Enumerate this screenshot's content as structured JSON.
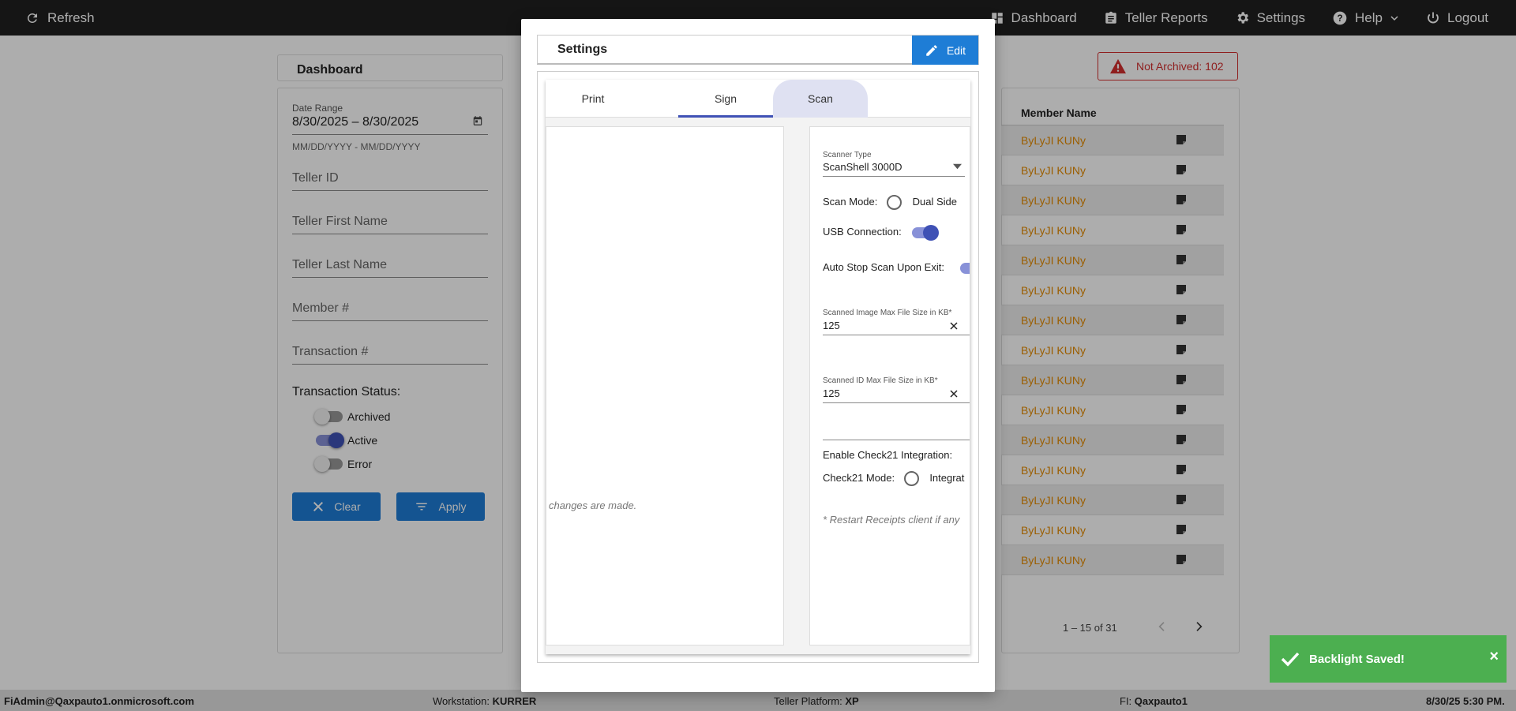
{
  "topbar": {
    "refresh": "Refresh",
    "dashboard": "Dashboard",
    "teller_reports": "Teller Reports",
    "settings": "Settings",
    "help": "Help",
    "logout": "Logout"
  },
  "dashboard": {
    "title": "Dashboard",
    "not_archived": "Not Archived: 102",
    "filters": {
      "date_range_label": "Date Range",
      "date_range_value": "8/30/2025 – 8/30/2025",
      "date_range_hint": "MM/DD/YYYY - MM/DD/YYYY",
      "teller_id": "Teller ID",
      "teller_first_name": "Teller First Name",
      "teller_last_name": "Teller Last Name",
      "member_number": "Member #",
      "transaction_number": "Transaction #",
      "status_title": "Transaction Status:",
      "status": [
        {
          "label": "Archived",
          "on": false
        },
        {
          "label": "Active",
          "on": true
        },
        {
          "label": "Error",
          "on": false
        }
      ],
      "clear": "Clear",
      "apply": "Apply"
    },
    "table": {
      "column_member_name": "Member Name",
      "rows": [
        "ByLyJI KUNy",
        "ByLyJI KUNy",
        "ByLyJI KUNy",
        "ByLyJI KUNy",
        "ByLyJI KUNy",
        "ByLyJI KUNy",
        "ByLyJI KUNy",
        "ByLyJI KUNy",
        "ByLyJI KUNy",
        "ByLyJI KUNy",
        "ByLyJI KUNy",
        "ByLyJI KUNy",
        "ByLyJI KUNy",
        "ByLyJI KUNy",
        "ByLyJI KUNy"
      ],
      "pager": "1 – 15 of 31"
    }
  },
  "modal": {
    "title": "Settings",
    "edit": "Edit",
    "tabs": [
      "Print",
      "Sign",
      "Scan"
    ],
    "left_note": "changes are made.",
    "scan": {
      "scanner_type_label": "Scanner Type",
      "scanner_type_value": "ScanShell 3000D",
      "scan_mode_label": "Scan Mode:",
      "scan_mode_option": "Dual Side",
      "usb_label": "USB Connection:",
      "auto_stop_label": "Auto Stop Scan Upon Exit:",
      "image_size_label": "Scanned Image Max File Size in KB*",
      "image_size_value": "125",
      "id_size_label": "Scanned ID Max File Size in KB*",
      "id_size_value": "125",
      "check21_label": "Enable Check21 Integration:",
      "check21_mode_label": "Check21 Mode:",
      "check21_mode_option": "Integrat",
      "restart_note": "* Restart Receipts client if any"
    }
  },
  "toast": {
    "message": "Backlight Saved!",
    "close": "×"
  },
  "footer": {
    "user": "FiAdmin@Qaxpauto1.onmicrosoft.com",
    "workstation_label": "Workstation:",
    "workstation_value": "KURRER",
    "platform_label": "Teller Platform:",
    "platform_value": "XP",
    "fi_label": "FI:",
    "fi_value": "Qaxpauto1",
    "datetime": "8/30/25 5:30 PM."
  },
  "colors": {
    "topbar": "#1f1f1f",
    "primary_button": "#1e7dd6",
    "toggle_on": "#3f51b5",
    "member_name": "#e58b00",
    "alert": "#d32f2f",
    "toast": "#4caf50"
  }
}
